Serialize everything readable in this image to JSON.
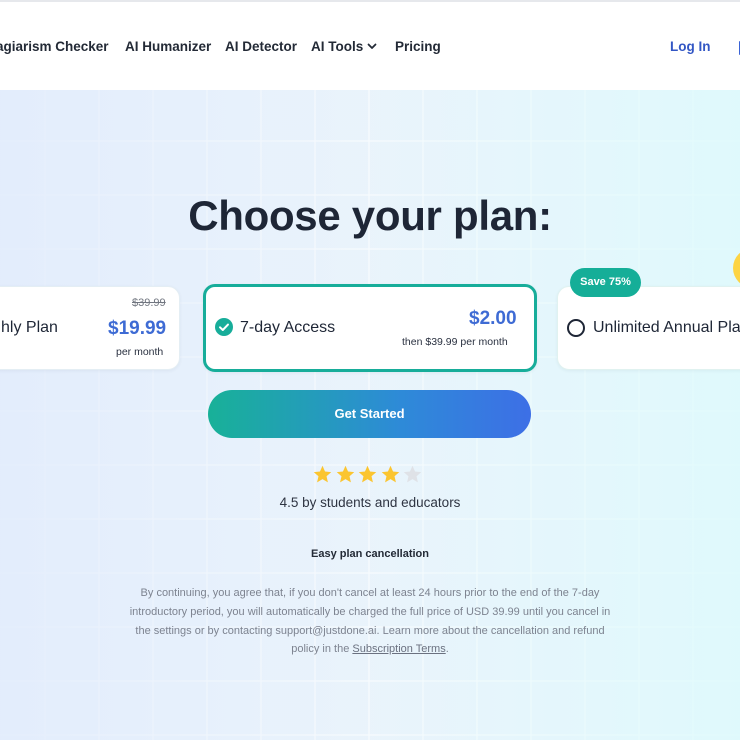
{
  "nav": {
    "items": [
      {
        "label": "agiarism Checker"
      },
      {
        "label": "AI Humanizer"
      },
      {
        "label": "AI Detector"
      },
      {
        "label": "AI Tools",
        "icon": "chevron-down-icon"
      },
      {
        "label": "Pricing"
      }
    ],
    "login": "Log In"
  },
  "page": {
    "title": "Choose your plan:"
  },
  "plans": [
    {
      "name": "hly Plan",
      "old_price": "$39.99",
      "price": "$19.99",
      "period": "per month",
      "selected": false
    },
    {
      "name": "7-day Access",
      "price": "$2.00",
      "period": "then $39.99 per month",
      "selected": true,
      "icon": "check-circle-icon"
    },
    {
      "name": "Unlimited Annual Pla",
      "badge": "Save 75%",
      "selected": false,
      "icon": "radio-empty-icon"
    }
  ],
  "cta": {
    "label": "Get Started"
  },
  "rating": {
    "stars": 4.5,
    "max": 5,
    "text": "4.5 by students and educators"
  },
  "cancellation": {
    "title": "Easy plan cancellation",
    "text_before_link": "By continuing, you agree that, if you don't cancel at least 24 hours prior to the end of the 7-day introductory period, you will automatically be charged the full price of USD 39.99 until you cancel in the settings or by contacting support@justdone.ai. Learn more about the cancellation and refund policy in the ",
    "link": "Subscription Terms",
    "text_after_link": "."
  },
  "colors": {
    "accent_teal": "#17ad9a",
    "accent_blue": "#3e6bd4",
    "star_gold": "#fbc530",
    "badge_yellow": "#fdd443"
  }
}
